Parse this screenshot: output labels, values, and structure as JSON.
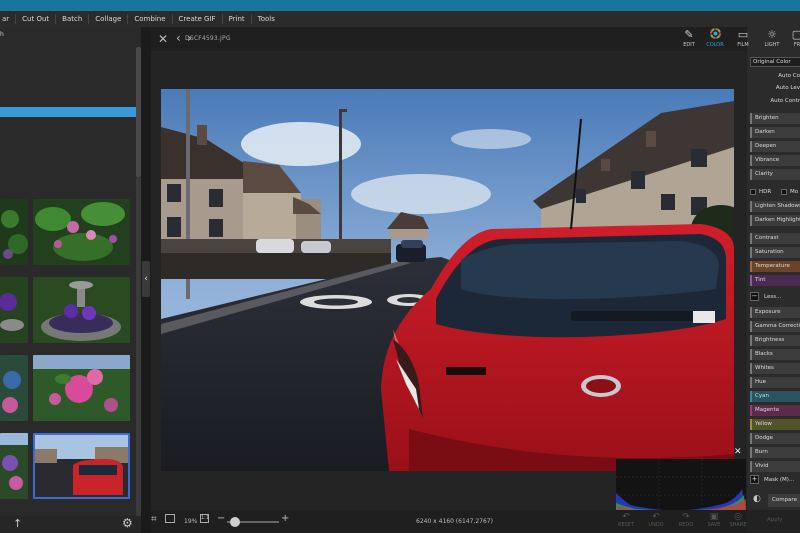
{
  "menubar": {
    "items": [
      "ar",
      "Cut Out",
      "Batch",
      "Collage",
      "Combine",
      "Create GIF",
      "Print",
      "Tools"
    ]
  },
  "left_panel": {
    "header": "h",
    "icons": {
      "up": "arrow-up-icon",
      "settings": "gear-icon"
    }
  },
  "viewer": {
    "filename": "DSCF4593.JPG",
    "zoom": "19%",
    "fit_label": "1:1",
    "dimensions": "6240 x 4160 (6147,2767)",
    "zoom_level": 0.19
  },
  "bottom_actions": [
    "RESET",
    "UNDO",
    "REDO",
    "SAVE",
    "SHARE"
  ],
  "right_panel": {
    "tools": [
      {
        "label": "EDIT",
        "icon": "edit-icon"
      },
      {
        "label": "COLOR",
        "icon": "color-wheel-icon",
        "active": true
      },
      {
        "label": "FILM",
        "icon": "film-icon"
      },
      {
        "label": "LIGHT",
        "icon": "light-icon"
      },
      {
        "label": "FR",
        "icon": "frame-icon"
      }
    ],
    "original_color": "Original Color",
    "auto": [
      "Auto Co",
      "Auto Lev",
      "Auto Contr"
    ],
    "group1": [
      "Brighten",
      "Darken",
      "Deepen",
      "Vibrance",
      "Clarity"
    ],
    "hdr": "HDR",
    "hdr2": "Mo",
    "group2": [
      "Lighten Shadows",
      "Darken Highlights"
    ],
    "group3": [
      "Contrast",
      "Saturation",
      "Temperature",
      "Tint"
    ],
    "less": "Less...",
    "group4": [
      "Exposure",
      "Gamma Correction",
      "Brightness",
      "Blacks",
      "Whites",
      "Hue",
      "Cyan",
      "Magenta",
      "Yellow",
      "Dodge",
      "Burn",
      "Vivid"
    ],
    "mask": "Mask (M)...",
    "compare": "Compare",
    "apply": "Apply"
  }
}
